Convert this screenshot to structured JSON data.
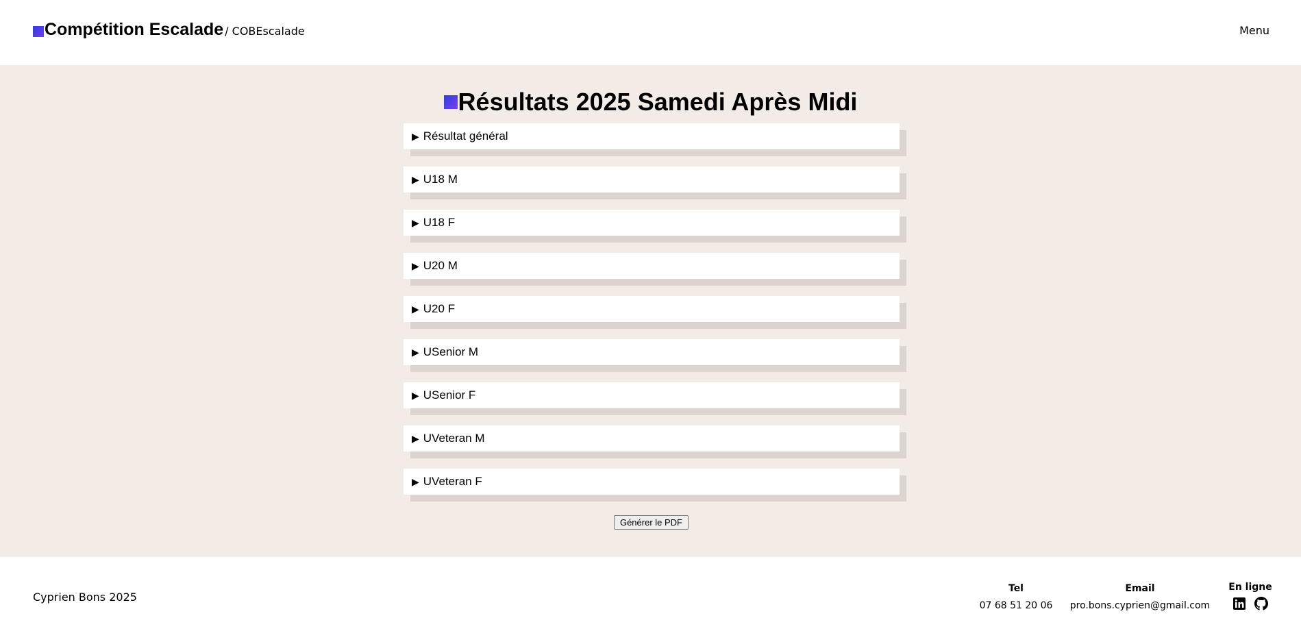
{
  "header": {
    "brand_title": "Compétition Escalade",
    "brand_sub": "/ COBEscalade",
    "menu_label": "Menu"
  },
  "main": {
    "title": "Résultats 2025 Samedi Après Midi",
    "sections": [
      {
        "label": "Résultat général"
      },
      {
        "label": "U18 M"
      },
      {
        "label": "U18 F"
      },
      {
        "label": "U20 M"
      },
      {
        "label": "U20 F"
      },
      {
        "label": "USenior M"
      },
      {
        "label": "USenior F"
      },
      {
        "label": "UVeteran M"
      },
      {
        "label": "UVeteran F"
      }
    ],
    "pdf_button": "Générer le PDF"
  },
  "footer": {
    "copyright": "Cyprien Bons 2025",
    "tel_label": "Tel",
    "tel_value": "07 68 51 20 06",
    "email_label": "Email",
    "email_value": "pro.bons.cyprien@gmail.com",
    "online_label": "En ligne",
    "social_icons": [
      "linkedin-icon",
      "github-icon"
    ]
  },
  "colors": {
    "accent_gradient_start": "#2f3fe0",
    "accent_gradient_end": "#6a3df0",
    "main_bg": "#f3ebe6",
    "shadow": "#dcd4cf"
  }
}
